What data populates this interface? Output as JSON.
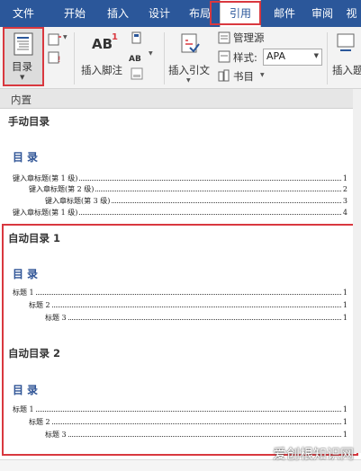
{
  "tabs": [
    "文件",
    "开始",
    "插入",
    "设计",
    "布局",
    "引用",
    "邮件",
    "审阅",
    "视"
  ],
  "ribbon": {
    "toc_label": "目录",
    "insert_footnote": "插入脚注",
    "footnote_icon_text": "AB",
    "footnote_sup": "1",
    "next_footnote_text": "AB",
    "insert_citation": "插入引文",
    "manage_sources": "管理源",
    "style_label": "样式:",
    "style_value": "APA",
    "bibliography": "书目",
    "insert_caption": "插入题"
  },
  "panel": {
    "gallery_header": "内置",
    "manual": {
      "title": "手动目录",
      "heading": "目录",
      "rows": [
        {
          "text": "键入章标题(第 1 级)",
          "page": "1"
        },
        {
          "text": "键入章标题(第 2 级)",
          "page": "2"
        },
        {
          "text": "键入章标题(第 3 级)",
          "page": "3"
        },
        {
          "text": "键入章标题(第 1 级)",
          "page": "4"
        }
      ]
    },
    "auto1": {
      "title": "自动目录 1",
      "heading": "目录",
      "rows": [
        {
          "text": "标题 1",
          "page": "1"
        },
        {
          "text": "标题 2",
          "page": "1"
        },
        {
          "text": "标题 3",
          "page": "1"
        }
      ]
    },
    "auto2": {
      "title": "自动目录 2",
      "heading": "目录",
      "rows": [
        {
          "text": "标题 1",
          "page": "1"
        },
        {
          "text": "标题 2",
          "page": "1"
        },
        {
          "text": "标题 3",
          "page": "1"
        }
      ]
    }
  },
  "watermark": "爱创根知识网",
  "colors": {
    "accent": "#2b579a",
    "highlight": "#d9383f",
    "toc_heading": "#2f5496"
  }
}
